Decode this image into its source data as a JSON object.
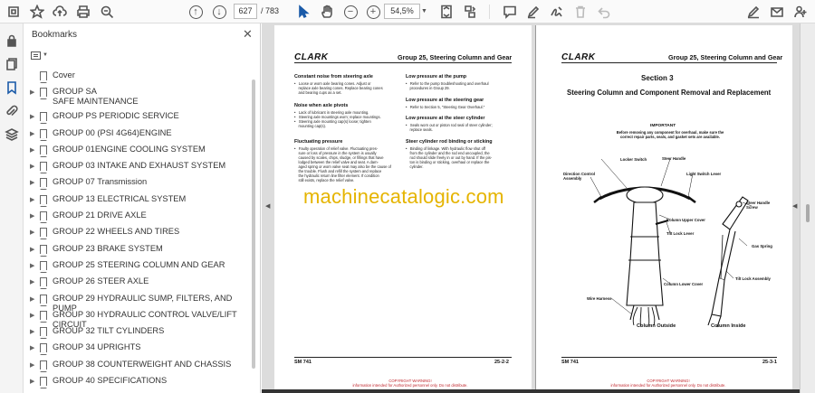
{
  "toolbar": {
    "current_page": "627",
    "page_separator": "/",
    "total_pages": "783",
    "zoom": "54,5%"
  },
  "bookmarks": {
    "title": "Bookmarks",
    "items": [
      {
        "label": "Cover",
        "expandable": false
      },
      {
        "label": "GROUP SA\nSAFE MAINTENANCE",
        "expandable": true
      },
      {
        "label": "GROUP PS PERIODIC SERVICE",
        "expandable": true
      },
      {
        "label": "GROUP 00 (PSI 4G64)ENGINE",
        "expandable": true
      },
      {
        "label": "GROUP 01ENGINE COOLING SYSTEM",
        "expandable": true
      },
      {
        "label": "GROUP 03 INTAKE AND EXHAUST SYSTEM",
        "expandable": true
      },
      {
        "label": "GROUP 07 Transmission",
        "expandable": true
      },
      {
        "label": "GROUP 13 ELECTRICAL SYSTEM",
        "expandable": true
      },
      {
        "label": "GROUP 21 DRIVE AXLE",
        "expandable": true
      },
      {
        "label": "GROUP 22 WHEELS AND TIRES",
        "expandable": true
      },
      {
        "label": "GROUP 23 BRAKE SYSTEM",
        "expandable": true
      },
      {
        "label": "GROUP 25 STEERING COLUMN AND GEAR",
        "expandable": true
      },
      {
        "label": "GROUP 26 STEER AXLE",
        "expandable": true
      },
      {
        "label": "GROUP 29 HYDRAULIC SUMP, FILTERS, AND PUMP",
        "expandable": true
      },
      {
        "label": "GROUP 30 HYDRAULIC CONTROL VALVE/LIFT CIRCUIT",
        "expandable": true
      },
      {
        "label": "GROUP 32 TILT CYLINDERS",
        "expandable": true
      },
      {
        "label": "GROUP 34 UPRIGHTS",
        "expandable": true
      },
      {
        "label": "GROUP 38 COUNTERWEIGHT AND CHASSIS",
        "expandable": true
      },
      {
        "label": "GROUP 40 SPECIFICATIONS",
        "expandable": true
      }
    ]
  },
  "left_page": {
    "logo": "CLARK",
    "header": "Group 25, Steering Column and Gear",
    "col1": [
      {
        "h": "Constant noise from steering axle",
        "t": "•   Loose or worn axle bearing cones. Adjust or\n    replace axle bearing cones. Replace bearing cones\n    and bearing cups as a set."
      },
      {
        "h": "Noise when axle pivots",
        "t": "•   Lack of lubricant in steering axle mounting.\n•   Steering axle mountings worn; replace mountings.\n•   Steering axle mounting cap(s) loose; tighten\n    mounting cap(s)."
      },
      {
        "h": "Fluctuating pressure",
        "t": "•   Faulty operation of relief valve. Fluctuating pres-\n    sure or loss of pressure in the system is usually\n    caused by scales, chips, sludge, or fillings that have\n    lodged between the relief valve and seat. A dam-\n    aged spring or worn valve seat may also be the cause of\n    the trouble. Flush and refill the system and replace\n    the hydraulic return line filter element. If condition\n    still exists, replace the relief valve."
      }
    ],
    "col2": [
      {
        "h": "Low pressure at the pump",
        "t": "•   Refer to the pump troubleshooting and overhaul\n    procedures in Group 29."
      },
      {
        "h": "Low pressure at the steering gear",
        "t": "•   Refer to Section 5, \"Steering Gear Overhaul.\""
      },
      {
        "h": "Low pressure at the steer cylinder",
        "t": "•   Seals worn out or piston rod seal of steer cylinder;\n    replace seals."
      },
      {
        "h": "Steer cylinder rod binding or sticking",
        "t": "•   Binding of linkage. With hydraulic flow shut off\n    from the cylinder and the rod end uncoupled, the\n    rod should slide freely in or out by hand. If the pis-\n    ton is binding or sticking, overhaul or replace the\n    cylinder."
      }
    ],
    "footer_left": "SM 741",
    "footer_right": "25-2-2",
    "copyright": "COPYRIGHT WARNING!\ninformation intended for Authorized personnel only. Do not distribute."
  },
  "right_page": {
    "logo": "CLARK",
    "header": "Group 25, Steering Column and Gear",
    "section": "Section 3",
    "subtitle": "Steering Column and Component Removal and Replacement",
    "important_h": "IMPORTANT",
    "important_t": "Before removing any component for overhaul, make sure the correct repair parts, seals, and gasket sets are available.",
    "callouts": {
      "locker_switch": "Locker Switch",
      "steer_handle": "Steer Handle",
      "light_switch_lever": "Light Switch Lever",
      "direction_control": "Direction Control\nAssembly",
      "column_upper_cover": "Column Upper Cover",
      "tilt_lock_lever": "Tilt Lock Lever",
      "steer_handle_screw": "Steer Handle\nScrew",
      "gas_spring": "Gas Spring",
      "tilt_lock_assembly": "Tilt Lock Assembly",
      "column_lower_cover": "Column Lower Cover",
      "wire_harness": "Wire Harness",
      "column_outside": "Column Outside",
      "column_inside": "Column Inside"
    },
    "footer_left": "SM 741",
    "footer_right": "25-3-1",
    "copyright": "COPYRIGHT WARNING!\ninformation intended for Authorized personnel only. Do not distribute."
  },
  "watermark": "machinecatalogic.com"
}
